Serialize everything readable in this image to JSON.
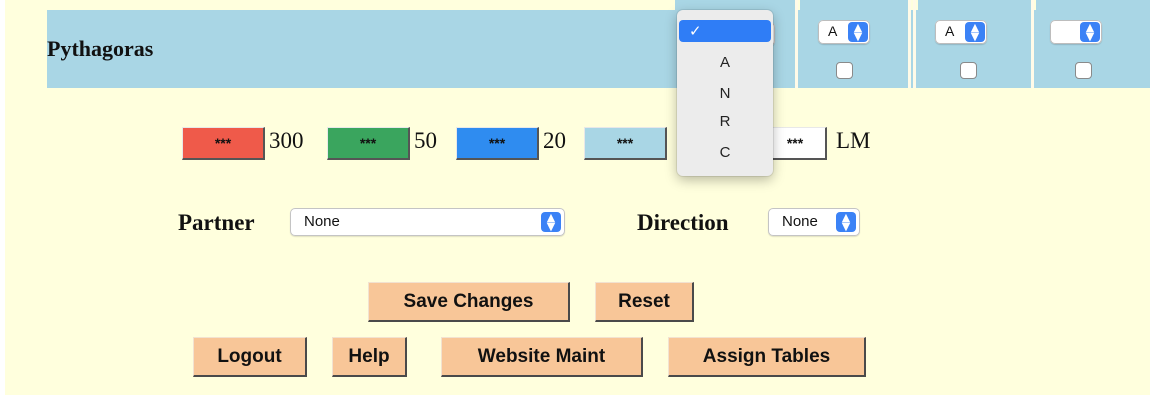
{
  "row": {
    "name": "Pythagoras"
  },
  "columns": [
    {
      "value": "A",
      "checked": false
    },
    {
      "value": "A",
      "checked": false
    },
    {
      "value": "",
      "checked": false
    }
  ],
  "dropdown": {
    "selected_mark": "✓",
    "options": [
      "A",
      "N",
      "R",
      "C"
    ]
  },
  "legend": {
    "buttons": [
      {
        "label": "***",
        "color": "#ef5a4a",
        "value": "300"
      },
      {
        "label": "***",
        "color": "#3aa55e",
        "value": "50"
      },
      {
        "label": "***",
        "color": "#2f8cf0",
        "value": "20"
      },
      {
        "label": "***",
        "color": "#a9d6e5",
        "value": ""
      },
      {
        "label": "***",
        "color": "#ffffff",
        "value": "LM"
      }
    ]
  },
  "partner": {
    "label": "Partner",
    "value": "None"
  },
  "direction": {
    "label": "Direction",
    "value": "None"
  },
  "actions": {
    "save": "Save Changes",
    "reset": "Reset",
    "logout": "Logout",
    "help": "Help",
    "maint": "Website Maint",
    "assign": "Assign Tables"
  },
  "colors": {
    "page_bg": "#ffffdd",
    "row_bg": "#a9d6e5",
    "action_button": "#f8c698",
    "select_accent": "#3b82f6"
  }
}
